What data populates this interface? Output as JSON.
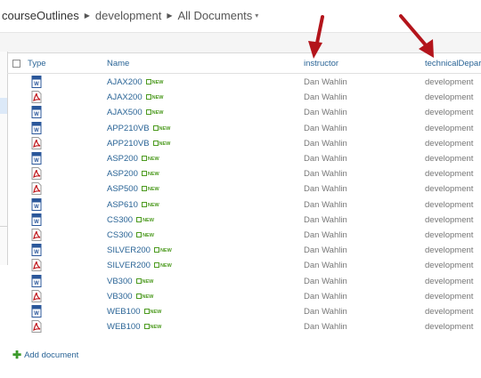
{
  "breadcrumb": {
    "items": [
      "courseOutlines",
      "development",
      "All Documents"
    ],
    "dropdown": "▾"
  },
  "table": {
    "headers": {
      "type": "Type",
      "name": "Name",
      "instructor": "instructor",
      "department": "technicalDepar"
    },
    "rows": [
      {
        "type": "word",
        "name": "AJAX200",
        "new": "NEW",
        "instructor": "Dan Wahlin",
        "department": "development"
      },
      {
        "type": "pdf",
        "name": "AJAX200",
        "new": "NEW",
        "instructor": "Dan Wahlin",
        "department": "development"
      },
      {
        "type": "word",
        "name": "AJAX500",
        "new": "NEW",
        "instructor": "Dan Wahlin",
        "department": "development"
      },
      {
        "type": "word",
        "name": "APP210VB",
        "new": "NEW",
        "instructor": "Dan Wahlin",
        "department": "development"
      },
      {
        "type": "pdf",
        "name": "APP210VB",
        "new": "NEW",
        "instructor": "Dan Wahlin",
        "department": "development"
      },
      {
        "type": "word",
        "name": "ASP200",
        "new": "NEW",
        "instructor": "Dan Wahlin",
        "department": "development"
      },
      {
        "type": "pdf",
        "name": "ASP200",
        "new": "NEW",
        "instructor": "Dan Wahlin",
        "department": "development"
      },
      {
        "type": "pdf",
        "name": "ASP500",
        "new": "NEW",
        "instructor": "Dan Wahlin",
        "department": "development"
      },
      {
        "type": "word",
        "name": "ASP610",
        "new": "NEW",
        "instructor": "Dan Wahlin",
        "department": "development"
      },
      {
        "type": "word",
        "name": "CS300",
        "new": "NEW",
        "instructor": "Dan Wahlin",
        "department": "development"
      },
      {
        "type": "pdf",
        "name": "CS300",
        "new": "NEW",
        "instructor": "Dan Wahlin",
        "department": "development"
      },
      {
        "type": "word",
        "name": "SILVER200",
        "new": "NEW",
        "instructor": "Dan Wahlin",
        "department": "development"
      },
      {
        "type": "pdf",
        "name": "SILVER200",
        "new": "NEW",
        "instructor": "Dan Wahlin",
        "department": "development"
      },
      {
        "type": "word",
        "name": "VB300",
        "new": "NEW",
        "instructor": "Dan Wahlin",
        "department": "development"
      },
      {
        "type": "pdf",
        "name": "VB300",
        "new": "NEW",
        "instructor": "Dan Wahlin",
        "department": "development"
      },
      {
        "type": "word",
        "name": "WEB100",
        "new": "NEW",
        "instructor": "Dan Wahlin",
        "department": "development"
      },
      {
        "type": "pdf",
        "name": "WEB100",
        "new": "NEW",
        "instructor": "Dan Wahlin",
        "department": "development"
      }
    ]
  },
  "footer": {
    "add_document": "Add document"
  },
  "colors": {
    "link": "#2a6496",
    "new_badge": "#4c9a1f",
    "arrow": "#b3141b",
    "word_icon": "#2b579a",
    "pdf_icon": "#c0161b"
  }
}
